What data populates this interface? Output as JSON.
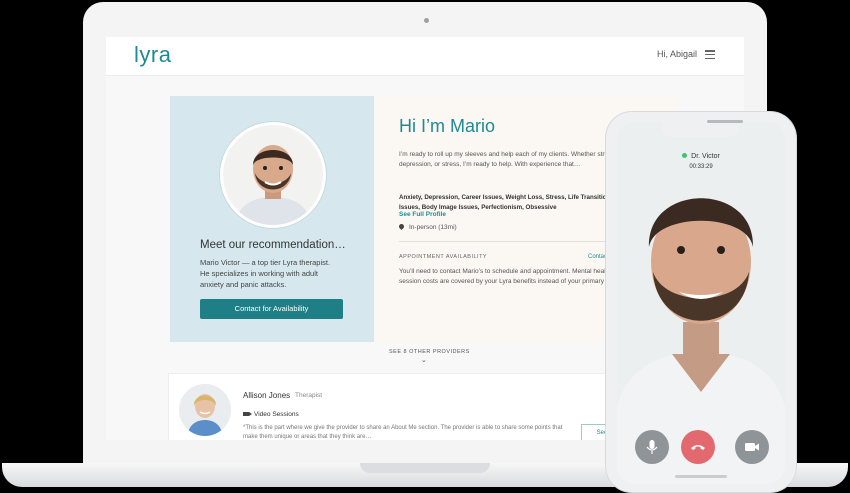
{
  "header": {
    "logo": "lyra",
    "greeting": "Hi, Abigail"
  },
  "recommendation": {
    "meet_title": "Meet our recommendation…",
    "meet_desc": "Mario Victor — a top tier Lyra therapist. He specializes in working with adult anxiety and panic attacks.",
    "contact_button": "Contact for Availability",
    "hi_title": "Hi I’m Mario",
    "intro": "I’m ready to roll up my sleeves and help each of my clients. Whether struggling with anxiety, depression, or stress, I’m ready to help. With experience that…",
    "specialties": "Anxiety, Depression, Career Issues, Weight Loss, Stress, Life Transitions, Purpose, Workplace Issues, Body Image Issues, Perfectionism, Obsessive",
    "full_profile_link": "See Full Profile",
    "inperson": "In-person (13mi)",
    "availability_label": "APPOINTMENT AVAILABILITY",
    "availability_link": "Contact",
    "availability_text": "You’ll need to contact Mario’s to schedule and appointment. Mental health is a Lyra client — your session costs are covered by your Lyra benefits instead of your primary health insurance."
  },
  "see_other": "SEE 8 OTHER PROVIDERS",
  "provider": {
    "name": "Allison Jones",
    "role": "Therapist",
    "session": "Video Sessions",
    "description": "*This is the part where we give the provider to share an About Me section. The provider is able to share some points that make them unique or areas that they think are…",
    "button": "See"
  },
  "call": {
    "name": "Dr. Victor",
    "time": "00:33:29"
  },
  "colors": {
    "brand": "#1f8a93",
    "button": "#1e7f86",
    "panel": "#d6e8ee",
    "end_call": "#e26a6f"
  }
}
